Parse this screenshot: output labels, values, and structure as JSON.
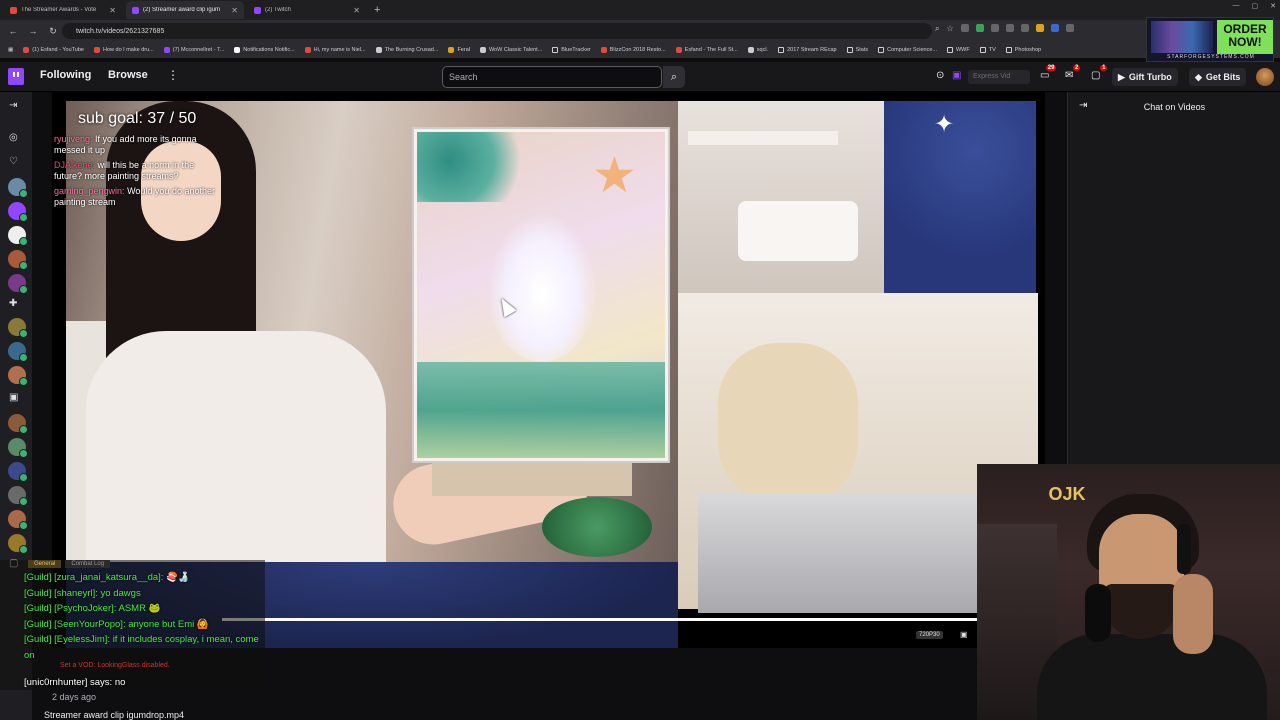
{
  "browser": {
    "tabs": [
      {
        "title": "The Streamer Awards - Vote",
        "active": false
      },
      {
        "title": "(2) Streamer award clip igum",
        "active": true
      },
      {
        "title": "(2) Twitch",
        "active": false
      }
    ],
    "url": "twitch.tv/videos/2621327685",
    "bookmarks": [
      "(1) Esfand - YouTube",
      "How do I make dru...",
      "(7) Mcconnellret - T...",
      "Notifications Notific...",
      "Hi, my name is Niel...",
      "The Burning Crusad...",
      "Feral",
      "WoW Classic Talent...",
      "BlueTracker",
      "BlizzCon 2018 Resto...",
      "Esfand - The Full St...",
      "sqcl.",
      "2017 Stream REcap",
      "Stats",
      "Computer Science...",
      "WWF",
      "TV",
      "Photoshop"
    ]
  },
  "ad": {
    "headline": "ORDER NOW!",
    "footer": "STARFORGESYSTEMS.COM"
  },
  "twitch_nav": {
    "following": "Following",
    "browse": "Browse",
    "search_placeholder": "Search",
    "prime_placeholder": "Express Vid",
    "inbox_count": "29",
    "notif_count": "2",
    "whisper_count": "1",
    "gift_turbo": "Gift Turbo",
    "get_bits": "Get Bits"
  },
  "video": {
    "sub_goal": "sub goal: 37 / 50",
    "overlay_chat": [
      {
        "user": "ryujiveng:",
        "text": "If you add more its gonna messed it up"
      },
      {
        "user": "DJAlkene:",
        "text": "will this be a norm in the future? more painting streams?"
      },
      {
        "user": "gaming_pengwin:",
        "text": "Would you do another painting stream"
      }
    ],
    "quality": "720P30",
    "progress": 0.98,
    "time_ago": "2 days ago",
    "title": "Streamer award clip igumdrop.mp4"
  },
  "chat_panel": {
    "title": "Chat on Videos"
  },
  "game_chat": {
    "tabs": [
      "General",
      "Combat Log"
    ],
    "lines": [
      "[Guild] [zura_janai_katsura__da]: 🍣🍶",
      "[Guild] [shaneyrl]: yo dawgs",
      "[Guild] [PsychoJoker]: ASMR 🐸",
      "[Guild] [SeenYourPopo]: anyone but Emi 🙆",
      "[Guild] [EyelessJim]: if it includes cosplay, i mean, come on"
    ],
    "system": "Set a VOD: LookingGlass disabled.",
    "say": "[unic0rnhunter] says: no"
  },
  "webcam": {
    "logo": "OJK"
  },
  "colors": {
    "twitch_purple": "#9146ff",
    "guild_green": "#3ff03f",
    "badge_red": "#eb0400"
  }
}
